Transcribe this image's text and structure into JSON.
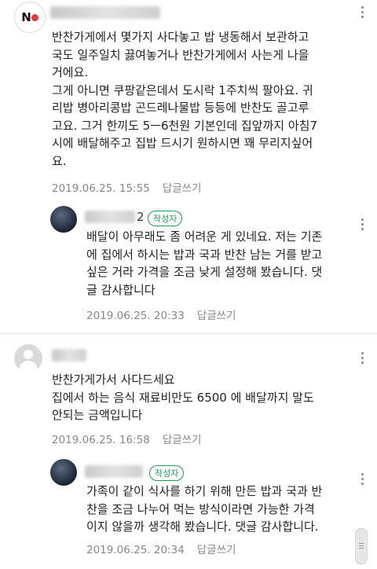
{
  "comments": [
    {
      "name_suffix": "",
      "text": "반찬가게에서 몇가지 사다놓고 밥 냉동해서 보관하고\n국도 일주일치 끓여놓거나 반찬가게에서 사는게 나을\n거에요.\n그게 아니면 쿠팡같은데서 도시락 1주치씩 팔아요. 귀\n리밥 병아리콩밥 곤드레나물밥 등등에 반찬도 골고루\n고요. 그거 한끼도 5ㅡ6천원 기본인데 집앞까지 아침7\n시에 배달해주고 집밥 드시기 원하시면 꽤 무리지싶어\n요.",
      "date": "2019.06.25. 15:55",
      "reply_label": "답글쓰기"
    },
    {
      "name_suffix": "2",
      "badge": "작성자",
      "text": "배달이 아무래도 좀 어려운 게 있네요. 저는 기존\n에 집에서 하시는 밥과 국과 반찬 남는 거를 받고\n싶은 거라 가격을 조금 낮게 설정해 봤습니다. 댓\n글 감사합니다",
      "date": "2019.06.25. 20:33",
      "reply_label": "답글쓰기"
    },
    {
      "name_suffix": "",
      "text": "반찬가게가서 사다드세요\n집에서 하는 음식 재료비만도 6500 에 배달까지 말도\n안되는 금액입니다",
      "date": "2019.06.25. 16:58",
      "reply_label": "답글쓰기"
    },
    {
      "name_suffix": "",
      "badge": "작성자",
      "text": "가족이 같이 식사를 하기 위해 만든 밥과 국과 반\n찬을 조금 나누어 먹는 방식이라면 가능한 가격\n이지 않을까 생각해 봤습니다. 댓글 감사합니다.",
      "date": "2019.06.25. 20:34",
      "reply_label": "답글쓰기"
    }
  ],
  "logo_text": "N",
  "colors": {
    "badge": "#1e9e53",
    "meta": "#888888"
  },
  "icons": [
    "more-vertical-icon",
    "default-avatar-icon",
    "scroll-handle-icon"
  ]
}
